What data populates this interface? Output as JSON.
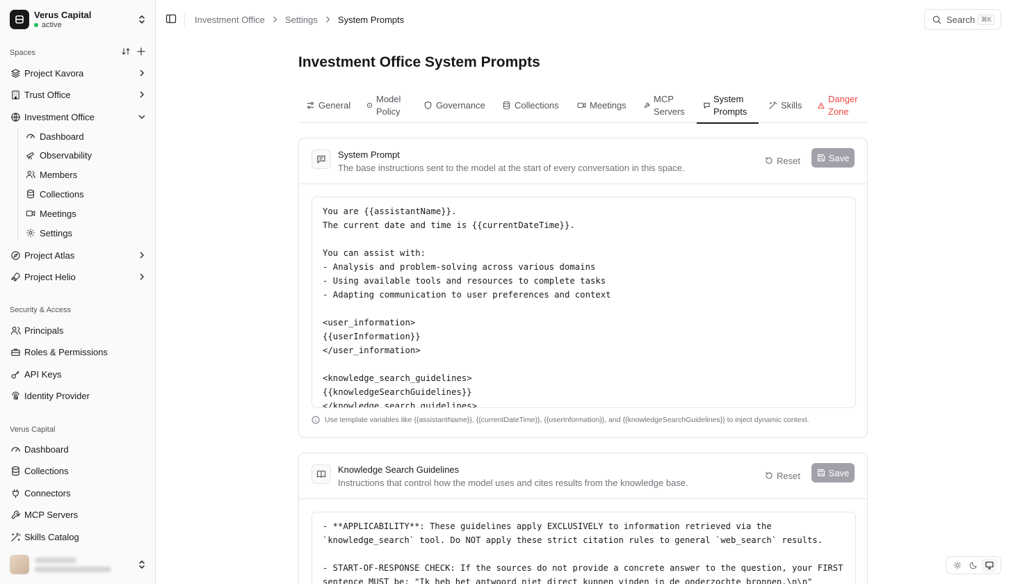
{
  "org": {
    "name": "Verus Capital",
    "status": "active"
  },
  "sidebar": {
    "spaces_label": "Spaces",
    "spaces": [
      {
        "label": "Project Kavora",
        "icon": "layers-icon"
      },
      {
        "label": "Trust Office",
        "icon": "building-icon"
      },
      {
        "label": "Investment Office",
        "icon": "globe-icon",
        "expanded": true,
        "children": [
          {
            "label": "Dashboard",
            "icon": "gauge-icon"
          },
          {
            "label": "Observability",
            "icon": "telescope-icon"
          },
          {
            "label": "Members",
            "icon": "users-icon"
          },
          {
            "label": "Collections",
            "icon": "database-icon"
          },
          {
            "label": "Meetings",
            "icon": "video-icon"
          },
          {
            "label": "Settings",
            "icon": "gear-icon"
          }
        ]
      },
      {
        "label": "Project Atlas",
        "icon": "compass-icon"
      },
      {
        "label": "Project Helio",
        "icon": "rocket-icon"
      }
    ],
    "security_label": "Security & Access",
    "security": [
      {
        "label": "Principals",
        "icon": "users-icon"
      },
      {
        "label": "Roles & Permissions",
        "icon": "briefcase-icon"
      },
      {
        "label": "API Keys",
        "icon": "key-icon"
      },
      {
        "label": "Identity Provider",
        "icon": "fingerprint-icon"
      }
    ],
    "org_label": "Verus Capital",
    "org_items": [
      {
        "label": "Dashboard",
        "icon": "gauge-icon"
      },
      {
        "label": "Collections",
        "icon": "database-icon"
      },
      {
        "label": "Connectors",
        "icon": "plug-icon"
      },
      {
        "label": "MCP Servers",
        "icon": "wrench-icon"
      },
      {
        "label": "Skills Catalog",
        "icon": "wand-icon"
      }
    ]
  },
  "breadcrumb": [
    "Investment Office",
    "Settings",
    "System Prompts"
  ],
  "search": {
    "label": "Search",
    "shortcut": "⌘K"
  },
  "page": {
    "title": "Investment Office System Prompts",
    "tabs": [
      {
        "label": "General",
        "icon": "sliders-icon"
      },
      {
        "label": "Model Policy",
        "icon": "cpu-icon"
      },
      {
        "label": "Governance",
        "icon": "shield-icon"
      },
      {
        "label": "Collections",
        "icon": "database-icon"
      },
      {
        "label": "Meetings",
        "icon": "video-icon"
      },
      {
        "label": "MCP Servers",
        "icon": "wrench-icon"
      },
      {
        "label": "System Prompts",
        "icon": "message-icon",
        "active": true
      },
      {
        "label": "Skills",
        "icon": "wand-icon"
      },
      {
        "label": "Danger Zone",
        "icon": "warning-icon",
        "danger": true
      }
    ]
  },
  "cards": {
    "system_prompt": {
      "title": "System Prompt",
      "description": "The base instructions sent to the model at the start of every conversation in this space.",
      "reset_label": "Reset",
      "save_label": "Save",
      "content": "You are {{assistantName}}.\nThe current date and time is {{currentDateTime}}.\n\nYou can assist with:\n- Analysis and problem-solving across various domains\n- Using available tools and resources to complete tasks\n- Adapting communication to user preferences and context\n\n<user_information>\n{{userInformation}}\n</user_information>\n\n<knowledge_search_guidelines>\n{{knowledgeSearchGuidelines}}\n</knowledge_search_guidelines>",
      "hint": "Use template variables like {{assistantName}}, {{currentDateTime}}, {{userInformation}}, and {{knowledgeSearchGuidelines}} to inject dynamic context."
    },
    "knowledge": {
      "title": "Knowledge Search Guidelines",
      "description": "Instructions that control how the model uses and cites results from the knowledge base.",
      "reset_label": "Reset",
      "save_label": "Save",
      "content": "- **APPLICABILITY**: These guidelines apply EXCLUSIVELY to information retrieved via the\n`knowledge_search` tool. Do NOT apply these strict citation rules to general `web_search` results.\n\n- START-OF-RESPONSE CHECK: If the sources do not provide a concrete answer to the question, your FIRST\nsentence MUST be: \"Ik heb het antwoord niet direct kunnen vinden in de onderzochte bronnen.\\n\\n\""
    }
  },
  "theme": [
    "sun-icon",
    "moon-icon",
    "monitor-icon"
  ]
}
